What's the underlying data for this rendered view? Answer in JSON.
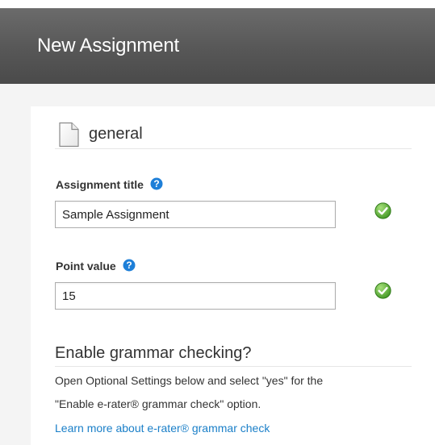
{
  "header": {
    "title": "New Assignment"
  },
  "section": {
    "icon": "document-icon",
    "label": "general"
  },
  "fields": {
    "title": {
      "label": "Assignment title",
      "value": "Sample Assignment",
      "help_icon": "question-circle-icon",
      "status_icon": "check-circle-icon"
    },
    "points": {
      "label": "Point value",
      "value": "15",
      "help_icon": "question-circle-icon",
      "status_icon": "check-circle-icon"
    }
  },
  "grammar": {
    "heading": "Enable grammar checking?",
    "line1": "Open Optional Settings below and select \"yes\" for the",
    "line2": "\"Enable e-rater® grammar check\" option.",
    "link": "Learn more about e-rater® grammar check"
  },
  "colors": {
    "header_bg": "#575757",
    "link": "#1a7fc8",
    "help_icon": "#1e7fd8",
    "check_green": "#4faa2a"
  }
}
